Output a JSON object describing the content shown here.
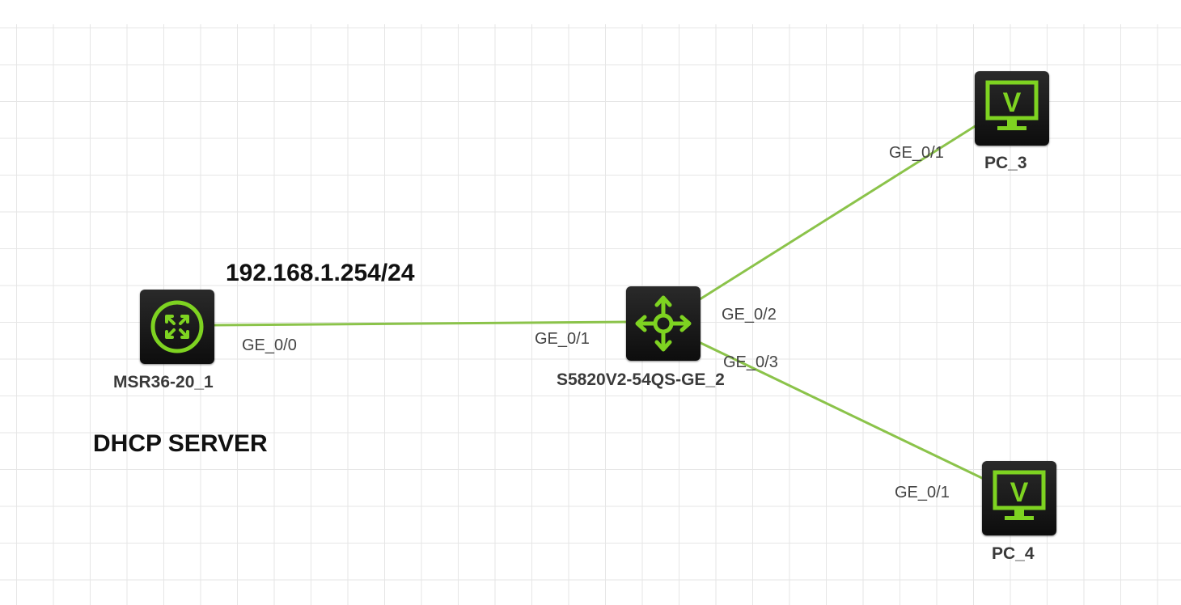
{
  "colors": {
    "link": "#8bc34a",
    "icon_green": "#7ed321",
    "device_bg": "#1a1a1a"
  },
  "annotations": {
    "ip_address": "192.168.1.254/24",
    "role": "DHCP SERVER"
  },
  "devices": {
    "router": {
      "name": "MSR36-20_1",
      "icon": "router-icon"
    },
    "switch": {
      "name": "S5820V2-54QS-GE_2",
      "icon": "switch-icon"
    },
    "pc3": {
      "name": "PC_3",
      "icon": "monitor-icon"
    },
    "pc4": {
      "name": "PC_4",
      "icon": "monitor-icon"
    }
  },
  "links": [
    {
      "from": "MSR36-20_1",
      "to": "S5820V2-54QS-GE_2",
      "from_port": "GE_0/0",
      "to_port": "GE_0/1"
    },
    {
      "from": "S5820V2-54QS-GE_2",
      "to": "PC_3",
      "from_port": "GE_0/2",
      "to_port": "GE_0/1"
    },
    {
      "from": "S5820V2-54QS-GE_2",
      "to": "PC_4",
      "from_port": "GE_0/3",
      "to_port": "GE_0/1"
    }
  ]
}
